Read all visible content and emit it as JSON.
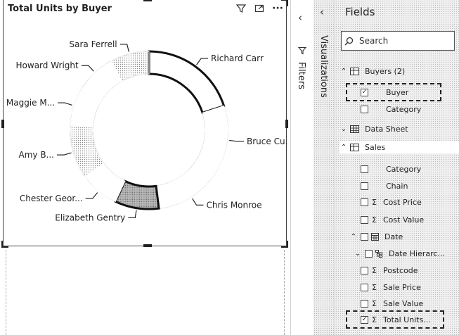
{
  "visual": {
    "title": "Total Units by Buyer",
    "tools": [
      "filter-icon",
      "focus-mode-icon",
      "more-options-icon"
    ],
    "more_label": "···"
  },
  "chart_data": {
    "type": "pie",
    "title": "Total Units by Buyer",
    "donut": true,
    "categories": [
      "Richard Carr",
      "Bruce Cu...",
      "Chris Monroe",
      "Elizabeth Gentry",
      "Chester Geor...",
      "Amy B...",
      "Maggie M...",
      "Howard Wright",
      "Sara Ferrell"
    ],
    "values": [
      20,
      14,
      14,
      9,
      8,
      11,
      8,
      8,
      8
    ],
    "highlighted": [
      "Richard Carr",
      "Elizabeth Gentry"
    ]
  },
  "panes": {
    "filters_label": "Filters",
    "visualizations_label": "Visualizations"
  },
  "fields": {
    "title": "Fields",
    "search_placeholder": "Search",
    "tables": [
      {
        "name": "Buyers (2)",
        "expanded": true,
        "fields": [
          {
            "label": "Buyer",
            "checked": true,
            "sigma": false,
            "highlighted": true
          },
          {
            "label": "Category",
            "checked": false,
            "sigma": false
          }
        ]
      },
      {
        "name": "Data Sheet",
        "expanded": false,
        "fields": []
      },
      {
        "name": "Sales",
        "expanded": true,
        "fields": [
          {
            "label": "Category",
            "checked": false,
            "sigma": false
          },
          {
            "label": "Chain",
            "checked": false,
            "sigma": false
          },
          {
            "label": "Cost Price",
            "checked": false,
            "sigma": true
          },
          {
            "label": "Cost Value",
            "checked": false,
            "sigma": true
          },
          {
            "label": "Date",
            "checked": false,
            "sigma": false,
            "kind": "date"
          },
          {
            "label": "Date Hierarc...",
            "checked": false,
            "sigma": false,
            "kind": "hierarchy"
          },
          {
            "label": "Postcode",
            "checked": false,
            "sigma": true
          },
          {
            "label": "Sale Price",
            "checked": false,
            "sigma": true
          },
          {
            "label": "Sale Value",
            "checked": false,
            "sigma": true
          },
          {
            "label": "Total Units...",
            "checked": true,
            "sigma": true,
            "highlighted": true
          }
        ]
      }
    ],
    "sigma_glyph": "Σ",
    "check_glyph": "✓"
  }
}
